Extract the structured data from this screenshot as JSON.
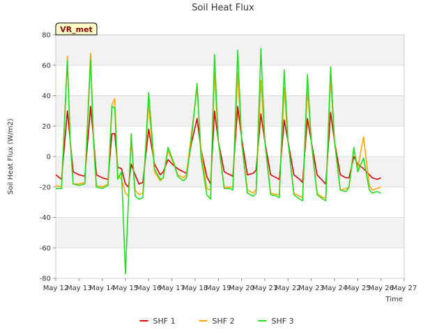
{
  "chart_data": {
    "type": "line",
    "title": "Soil Heat Flux",
    "xlabel": "Time",
    "ylabel": "Soil Heat Flux (W/m2)",
    "ylim": [
      -80,
      80
    ],
    "yticks": [
      -80,
      -60,
      -40,
      -20,
      0,
      20,
      40,
      60,
      80
    ],
    "xlim": [
      "May 12",
      "May 27"
    ],
    "xticks": [
      "May 12",
      "May 13",
      "May 14",
      "May 15",
      "May 16",
      "May 17",
      "May 18",
      "May 19",
      "May 20",
      "May 21",
      "May 22",
      "May 23",
      "May 24",
      "May 25",
      "May 26",
      "May 27"
    ],
    "grid": true,
    "banded_background": true,
    "legend_position": "bottom-center",
    "station_badge": "VR_met",
    "series": [
      {
        "name": "SHF 1",
        "color": "#dd0000",
        "x": [
          "May 12 00:00",
          "May 12 06:00",
          "May 12 12:00",
          "May 12 15:00",
          "May 12 18:00",
          "May 13 00:00",
          "May 13 06:00",
          "May 13 12:00",
          "May 13 15:00",
          "May 13 18:00",
          "May 14 00:00",
          "May 14 06:00",
          "May 14 10:00",
          "May 14 13:00",
          "May 14 16:00",
          "May 14 20:00",
          "May 15 00:00",
          "May 15 03:00",
          "May 15 06:00",
          "May 15 10:00",
          "May 15 14:00",
          "May 15 18:00",
          "May 16 00:00",
          "May 16 06:00",
          "May 16 12:00",
          "May 16 15:00",
          "May 16 20:00",
          "May 17 02:00",
          "May 17 06:00",
          "May 17 12:00",
          "May 17 15:00",
          "May 17 20:00",
          "May 18 02:00",
          "May 18 06:00",
          "May 18 12:00",
          "May 18 16:00",
          "May 18 20:00",
          "May 19 00:00",
          "May 19 06:00",
          "May 19 12:00",
          "May 19 15:00",
          "May 19 20:00",
          "May 20 00:00",
          "May 20 06:00",
          "May 20 12:00",
          "May 20 15:00",
          "May 20 20:00",
          "May 21 00:00",
          "May 21 06:00",
          "May 21 12:00",
          "May 21 15:00",
          "May 21 20:00",
          "May 22 00:00",
          "May 22 06:00",
          "May 22 12:00",
          "May 22 15:00",
          "May 22 20:00",
          "May 23 00:00",
          "May 23 06:00",
          "May 23 12:00",
          "May 23 15:00",
          "May 23 20:00",
          "May 24 00:00",
          "May 24 06:00",
          "May 24 12:00",
          "May 24 15:00",
          "May 24 20:00",
          "May 25 00:00",
          "May 25 06:00",
          "May 25 12:00",
          "May 25 15:00",
          "May 25 20:00",
          "May 26 00:00"
        ],
        "values": [
          -12,
          -15,
          30,
          10,
          -10,
          -12,
          -13,
          33,
          12,
          -12,
          -14,
          -15,
          15,
          15,
          -7,
          -8,
          -18,
          -20,
          -5,
          -12,
          -18,
          -17,
          18,
          -5,
          -12,
          -10,
          -2,
          -6,
          -8,
          -10,
          -11,
          8,
          25,
          5,
          -13,
          -18,
          30,
          10,
          -10,
          -12,
          -13,
          33,
          12,
          -12,
          -11,
          -9,
          28,
          10,
          -12,
          -14,
          -15,
          24,
          10,
          -12,
          -15,
          -17,
          25,
          10,
          -12,
          -16,
          -18,
          29,
          10,
          -12,
          -14,
          -14,
          0,
          -5,
          -8,
          -12,
          -14,
          -15,
          -14
        ]
      },
      {
        "name": "SHF 2",
        "color": "#ffa500",
        "x": [
          "May 12 00:00",
          "May 12 06:00",
          "May 12 12:00",
          "May 12 15:00",
          "May 12 18:00",
          "May 13 00:00",
          "May 13 06:00",
          "May 13 12:00",
          "May 13 15:00",
          "May 13 18:00",
          "May 14 00:00",
          "May 14 06:00",
          "May 14 10:00",
          "May 14 13:00",
          "May 14 16:00",
          "May 14 20:00",
          "May 15 00:00",
          "May 15 03:00",
          "May 15 06:00",
          "May 15 10:00",
          "May 15 14:00",
          "May 15 18:00",
          "May 16 00:00",
          "May 16 06:00",
          "May 16 12:00",
          "May 16 15:00",
          "May 16 20:00",
          "May 17 02:00",
          "May 17 06:00",
          "May 17 12:00",
          "May 17 15:00",
          "May 17 20:00",
          "May 18 02:00",
          "May 18 06:00",
          "May 18 12:00",
          "May 18 16:00",
          "May 18 20:00",
          "May 19 00:00",
          "May 19 06:00",
          "May 19 12:00",
          "May 19 15:00",
          "May 19 20:00",
          "May 20 00:00",
          "May 20 06:00",
          "May 20 12:00",
          "May 20 15:00",
          "May 20 20:00",
          "May 21 00:00",
          "May 21 06:00",
          "May 21 12:00",
          "May 21 15:00",
          "May 21 20:00",
          "May 22 00:00",
          "May 22 06:00",
          "May 22 12:00",
          "May 22 15:00",
          "May 22 20:00",
          "May 23 00:00",
          "May 23 06:00",
          "May 23 12:00",
          "May 23 15:00",
          "May 23 20:00",
          "May 24 00:00",
          "May 24 06:00",
          "May 24 12:00",
          "May 24 15:00",
          "May 24 20:00",
          "May 25 00:00",
          "May 25 06:00",
          "May 25 12:00",
          "May 25 15:00",
          "May 25 20:00",
          "May 26 00:00"
        ],
        "values": [
          -19,
          -20,
          66,
          10,
          -18,
          -18,
          -17,
          68,
          10,
          -19,
          -20,
          -18,
          34,
          38,
          -12,
          -15,
          -24,
          -26,
          10,
          -22,
          -25,
          -24,
          35,
          -10,
          -16,
          -14,
          4,
          -5,
          -12,
          -14,
          -12,
          14,
          45,
          5,
          -21,
          -22,
          55,
          10,
          -20,
          -20,
          -20,
          55,
          10,
          -22,
          -24,
          -22,
          50,
          10,
          -24,
          -25,
          -25,
          45,
          10,
          -24,
          -26,
          -27,
          45,
          10,
          -24,
          -27,
          -27,
          52,
          10,
          -22,
          -21,
          -20,
          5,
          -8,
          13,
          -19,
          -22,
          -21,
          -20
        ]
      },
      {
        "name": "SHF 3",
        "color": "#22dd22",
        "x": [
          "May 12 00:00",
          "May 12 06:00",
          "May 12 12:00",
          "May 12 15:00",
          "May 12 18:00",
          "May 13 00:00",
          "May 13 06:00",
          "May 13 12:00",
          "May 13 15:00",
          "May 13 18:00",
          "May 14 00:00",
          "May 14 06:00",
          "May 14 10:00",
          "May 14 13:00",
          "May 14 16:00",
          "May 14 20:00",
          "May 15 00:00",
          "May 15 03:00",
          "May 15 06:00",
          "May 15 10:00",
          "May 15 14:00",
          "May 15 18:00",
          "May 16 00:00",
          "May 16 06:00",
          "May 16 12:00",
          "May 16 15:00",
          "May 16 20:00",
          "May 17 02:00",
          "May 17 06:00",
          "May 17 12:00",
          "May 17 15:00",
          "May 17 20:00",
          "May 18 02:00",
          "May 18 06:00",
          "May 18 12:00",
          "May 18 16:00",
          "May 18 20:00",
          "May 19 00:00",
          "May 19 06:00",
          "May 19 12:00",
          "May 19 15:00",
          "May 19 20:00",
          "May 20 00:00",
          "May 20 06:00",
          "May 20 12:00",
          "May 20 15:00",
          "May 20 20:00",
          "May 21 00:00",
          "May 21 06:00",
          "May 21 12:00",
          "May 21 15:00",
          "May 21 20:00",
          "May 22 00:00",
          "May 22 06:00",
          "May 22 12:00",
          "May 22 15:00",
          "May 22 20:00",
          "May 23 00:00",
          "May 23 06:00",
          "May 23 12:00",
          "May 23 15:00",
          "May 23 20:00",
          "May 24 00:00",
          "May 24 06:00",
          "May 24 12:00",
          "May 24 15:00",
          "May 24 20:00",
          "May 25 00:00",
          "May 25 06:00",
          "May 25 12:00",
          "May 25 15:00",
          "May 25 20:00",
          "May 26 00:00"
        ],
        "values": [
          -21,
          -21,
          63,
          10,
          -18,
          -19,
          -18,
          64,
          10,
          -20,
          -21,
          -19,
          33,
          32,
          -15,
          -10,
          -77,
          -30,
          15,
          -26,
          -28,
          -27,
          42,
          -8,
          -15,
          -14,
          6,
          -4,
          -13,
          -16,
          -14,
          10,
          48,
          0,
          -25,
          -28,
          67,
          10,
          -21,
          -21,
          -22,
          70,
          10,
          -24,
          -26,
          -24,
          71,
          10,
          -25,
          -26,
          -27,
          57,
          10,
          -25,
          -28,
          -29,
          54,
          10,
          -25,
          -28,
          -29,
          59,
          10,
          -22,
          -23,
          -20,
          6,
          -10,
          -1,
          -22,
          -24,
          -23,
          -24
        ]
      }
    ]
  }
}
